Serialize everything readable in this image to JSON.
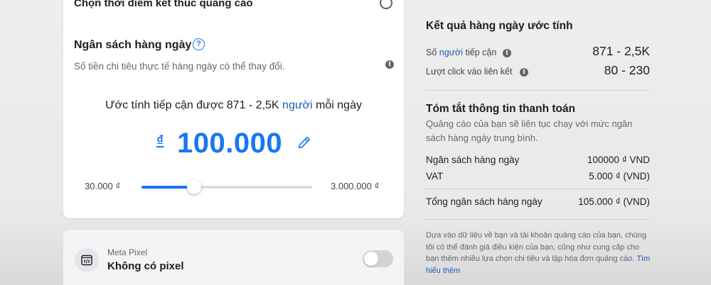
{
  "budget_card": {
    "end_time_label": "Chọn thời điểm kết thúc quảng cáo",
    "title": "Ngân sách hàng ngày",
    "help_glyph": "?",
    "description": "Số tiền chi tiêu thực tế hàng ngày có thể thay đổi.",
    "info_glyph": "i",
    "estimate_prefix": "Ước tính tiếp cận được 871 - 2,5K ",
    "estimate_link": "người",
    "estimate_suffix": " mỗi ngày",
    "currency_symbol": "₫",
    "amount": "100.000",
    "slider_min_label": "30.000 ₫",
    "slider_max_label": "3.000.000 ₫",
    "slider_fraction": 0.31
  },
  "pixel_card": {
    "label": "Meta Pixel",
    "value": "Không có pixel",
    "toggle_on": false
  },
  "summary": {
    "estimate_title": "Kết quả hàng ngày ước tính",
    "reach_label_prefix": "Số ",
    "reach_label_link": "người",
    "reach_label_suffix": " tiếp cận",
    "reach_value": "871 - 2,5K",
    "clicks_label": "Lượt click vào liên kết",
    "clicks_value": "80 - 230",
    "payment_title": "Tóm tắt thông tin thanh toán",
    "payment_desc": "Quảng cáo của bạn sẽ liên tục chạy với mức ngân sách hàng ngày trung bình.",
    "rows": [
      {
        "label": "Ngân sách hàng ngày",
        "value": "100000 ₫ VND"
      },
      {
        "label": "VAT",
        "value": "5.000 ₫ (VND)"
      }
    ],
    "total_label": "Tổng ngân sách hàng ngày",
    "total_value": "105.000 ₫ (VND)",
    "disclaimer": "Dựa vào dữ liệu về bạn và tài khoản quảng cáo của bạn, chúng tôi có thể đánh giá điều kiện của bạn, cũng như cung cấp cho bạn thêm nhiều lựa chọn chi tiêu và lập hóa đơn quảng cáo. ",
    "learn_more": "Tìm hiểu thêm"
  },
  "colors": {
    "accent": "#1877f2",
    "link": "#1a5fb4",
    "muted_text": "#65676b"
  },
  "icons": [
    "help-icon",
    "info-icon",
    "pencil-icon",
    "code-icon"
  ]
}
